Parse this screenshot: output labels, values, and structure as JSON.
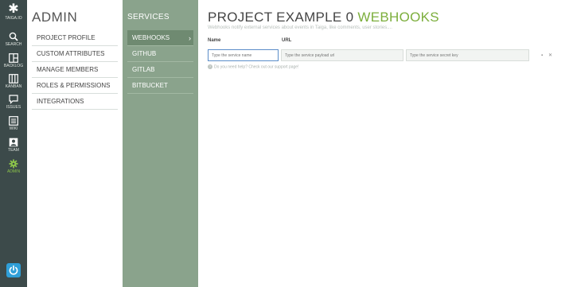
{
  "nav": {
    "logo_text": "TAIGA.IO",
    "items": [
      {
        "label": "Search",
        "icon": "search-icon"
      },
      {
        "label": "Backlog",
        "icon": "backlog-icon"
      },
      {
        "label": "Kanban",
        "icon": "kanban-icon"
      },
      {
        "label": "Issues",
        "icon": "issues-icon"
      },
      {
        "label": "Wiki",
        "icon": "wiki-icon"
      },
      {
        "label": "Team",
        "icon": "team-icon"
      },
      {
        "label": "Admin",
        "icon": "gear-icon",
        "active": true
      }
    ],
    "power_icon": "power-icon"
  },
  "admin": {
    "title": "ADMIN",
    "menu": [
      {
        "label": "PROJECT PROFILE"
      },
      {
        "label": "CUSTOM ATTRIBUTES"
      },
      {
        "label": "MANAGE MEMBERS"
      },
      {
        "label": "ROLES & PERMISSIONS"
      },
      {
        "label": "INTEGRATIONS"
      }
    ]
  },
  "services": {
    "title": "SERVICES",
    "items": [
      {
        "label": "WEBHOOKS",
        "active": true
      },
      {
        "label": "GITHUB"
      },
      {
        "label": "GITLAB"
      },
      {
        "label": "BITBUCKET"
      }
    ]
  },
  "page": {
    "title_prefix": "PROJECT EXAMPLE 0",
    "title_accent": "WEBHOOKS",
    "subtitle": "Webhooks notify external services about events in Taiga, like comments, user stories....",
    "columns": {
      "name": "Name",
      "url": "URL"
    },
    "form": {
      "name_placeholder": "Type the service name",
      "url_placeholder": "Type the service payload url",
      "key_placeholder": "Type the service secret key"
    },
    "help_text": "Do you need help? Check out our support page!"
  },
  "colors": {
    "nav_bg": "#3c4a4a",
    "services_bg": "#8aa38c",
    "accent_green": "#7cae3c",
    "power_blue": "#2f9fd8"
  }
}
